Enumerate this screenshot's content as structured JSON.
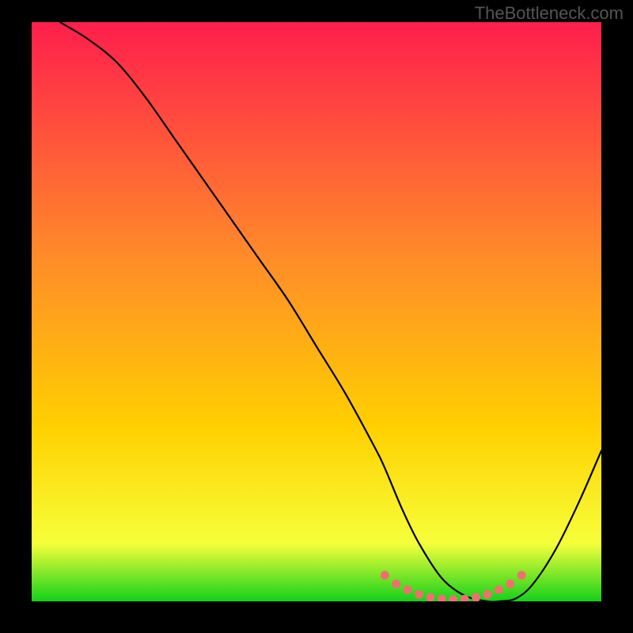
{
  "watermark": "TheBottleneck.com",
  "chart_data": {
    "type": "line",
    "title": "",
    "xlabel": "",
    "ylabel": "",
    "xlim": [
      0,
      100
    ],
    "ylim": [
      0,
      100
    ],
    "grid": false,
    "background_gradient": {
      "top": "#ff1e4c",
      "mid": "#ffd000",
      "bottom": "#14d11a"
    },
    "series": [
      {
        "name": "curve",
        "x": [
          5,
          10,
          15,
          20,
          25,
          30,
          35,
          40,
          45,
          50,
          55,
          60,
          62,
          65,
          68,
          72,
          76,
          80,
          82,
          85,
          88,
          92,
          96,
          100
        ],
        "y": [
          100,
          97,
          93,
          87,
          80,
          73,
          66,
          59,
          52,
          44,
          36,
          27,
          23,
          16,
          10,
          4,
          1,
          0,
          0,
          0.5,
          3,
          9,
          17,
          26
        ]
      }
    ],
    "markers": {
      "name": "optimum-band",
      "color": "#ef6f6f",
      "x": [
        62,
        64,
        66,
        68,
        70,
        72,
        74,
        76,
        78,
        80,
        82,
        84,
        86
      ],
      "y": [
        4.5,
        3.0,
        2.0,
        1.2,
        0.7,
        0.4,
        0.3,
        0.4,
        0.7,
        1.2,
        2.0,
        3.0,
        4.5
      ]
    }
  }
}
